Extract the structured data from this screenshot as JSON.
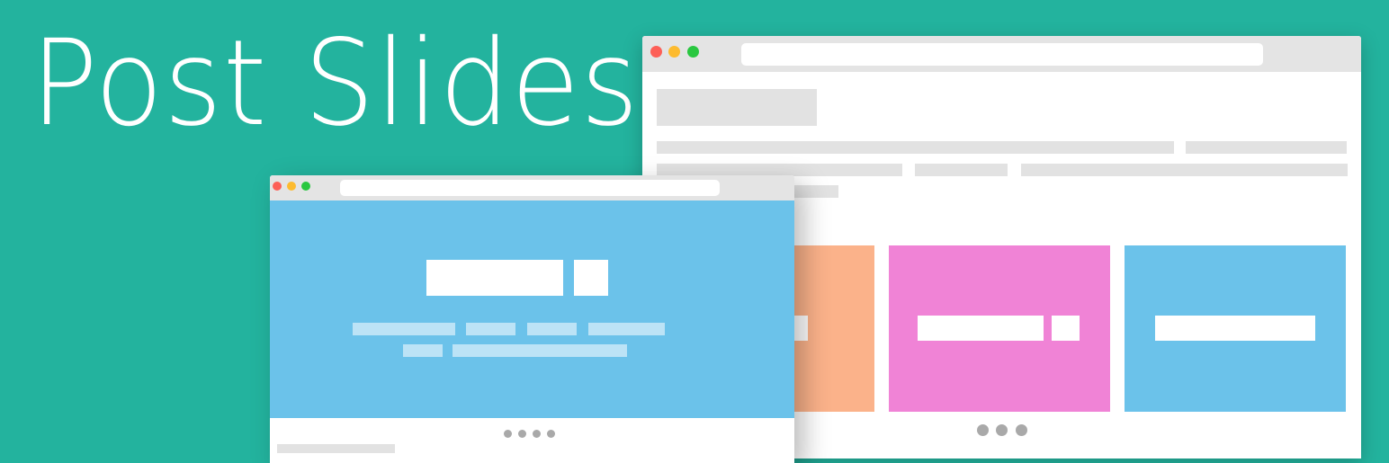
{
  "banner": {
    "title": "Post Slides",
    "colors": {
      "background": "#23b39e",
      "card_orange": "#fbb28a",
      "card_pink": "#f083d6",
      "card_blue": "#6bc2ea",
      "hero_blue": "#6bc2ea"
    }
  },
  "back_window": {
    "traffic_lights": [
      "#fd5f57",
      "#fdbb2f",
      "#29c740"
    ],
    "cards": [
      {
        "color": "#fbb28a",
        "bars": 1
      },
      {
        "color": "#f083d6",
        "bars": 2
      },
      {
        "color": "#6bc2ea",
        "bars": 1
      }
    ],
    "pager_dots": 3
  },
  "front_window": {
    "traffic_lights": [
      "#fd5f57",
      "#fdbb2f",
      "#29c740"
    ],
    "pager_dots": 4
  }
}
